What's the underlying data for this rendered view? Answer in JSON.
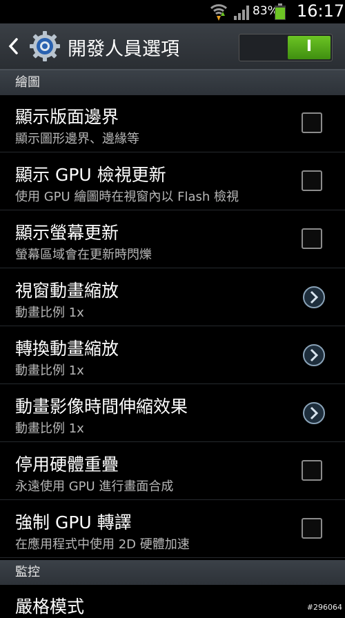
{
  "status_bar": {
    "battery_percent": "83%",
    "time": "16:17",
    "icons": [
      "wifi-icon",
      "signal-icon",
      "battery-icon"
    ]
  },
  "action_bar": {
    "title": "開發人員選項",
    "toggle_label": "I",
    "toggle_on": true,
    "accent": "#5cb81a"
  },
  "sections": [
    {
      "header": "繪圖",
      "rows": [
        {
          "title": "顯示版面邊界",
          "summary": "顯示圖形邊界、邊緣等",
          "control": "checkbox",
          "checked": false
        },
        {
          "title": "顯示 GPU 檢視更新",
          "summary": "使用 GPU 繪圖時在視窗內以 Flash 檢視",
          "control": "checkbox",
          "checked": false
        },
        {
          "title": "顯示螢幕更新",
          "summary": "螢幕區域會在更新時閃爍",
          "control": "checkbox",
          "checked": false
        },
        {
          "title": "視窗動畫縮放",
          "summary": "動畫比例 1x",
          "control": "chevron"
        },
        {
          "title": "轉換動畫縮放",
          "summary": "動畫比例 1x",
          "control": "chevron"
        },
        {
          "title": "動畫影像時間伸縮效果",
          "summary": "動畫比例 1x",
          "control": "chevron"
        },
        {
          "title": "停用硬體重疊",
          "summary": "永遠使用 GPU 進行畫面合成",
          "control": "checkbox",
          "checked": false
        },
        {
          "title": "強制 GPU 轉譯",
          "summary": "在應用程式中使用 2D 硬體加速",
          "control": "checkbox",
          "checked": false
        }
      ]
    },
    {
      "header": "監控",
      "rows": [
        {
          "title": "嚴格模式"
        }
      ]
    }
  ],
  "watermark": "#296064"
}
